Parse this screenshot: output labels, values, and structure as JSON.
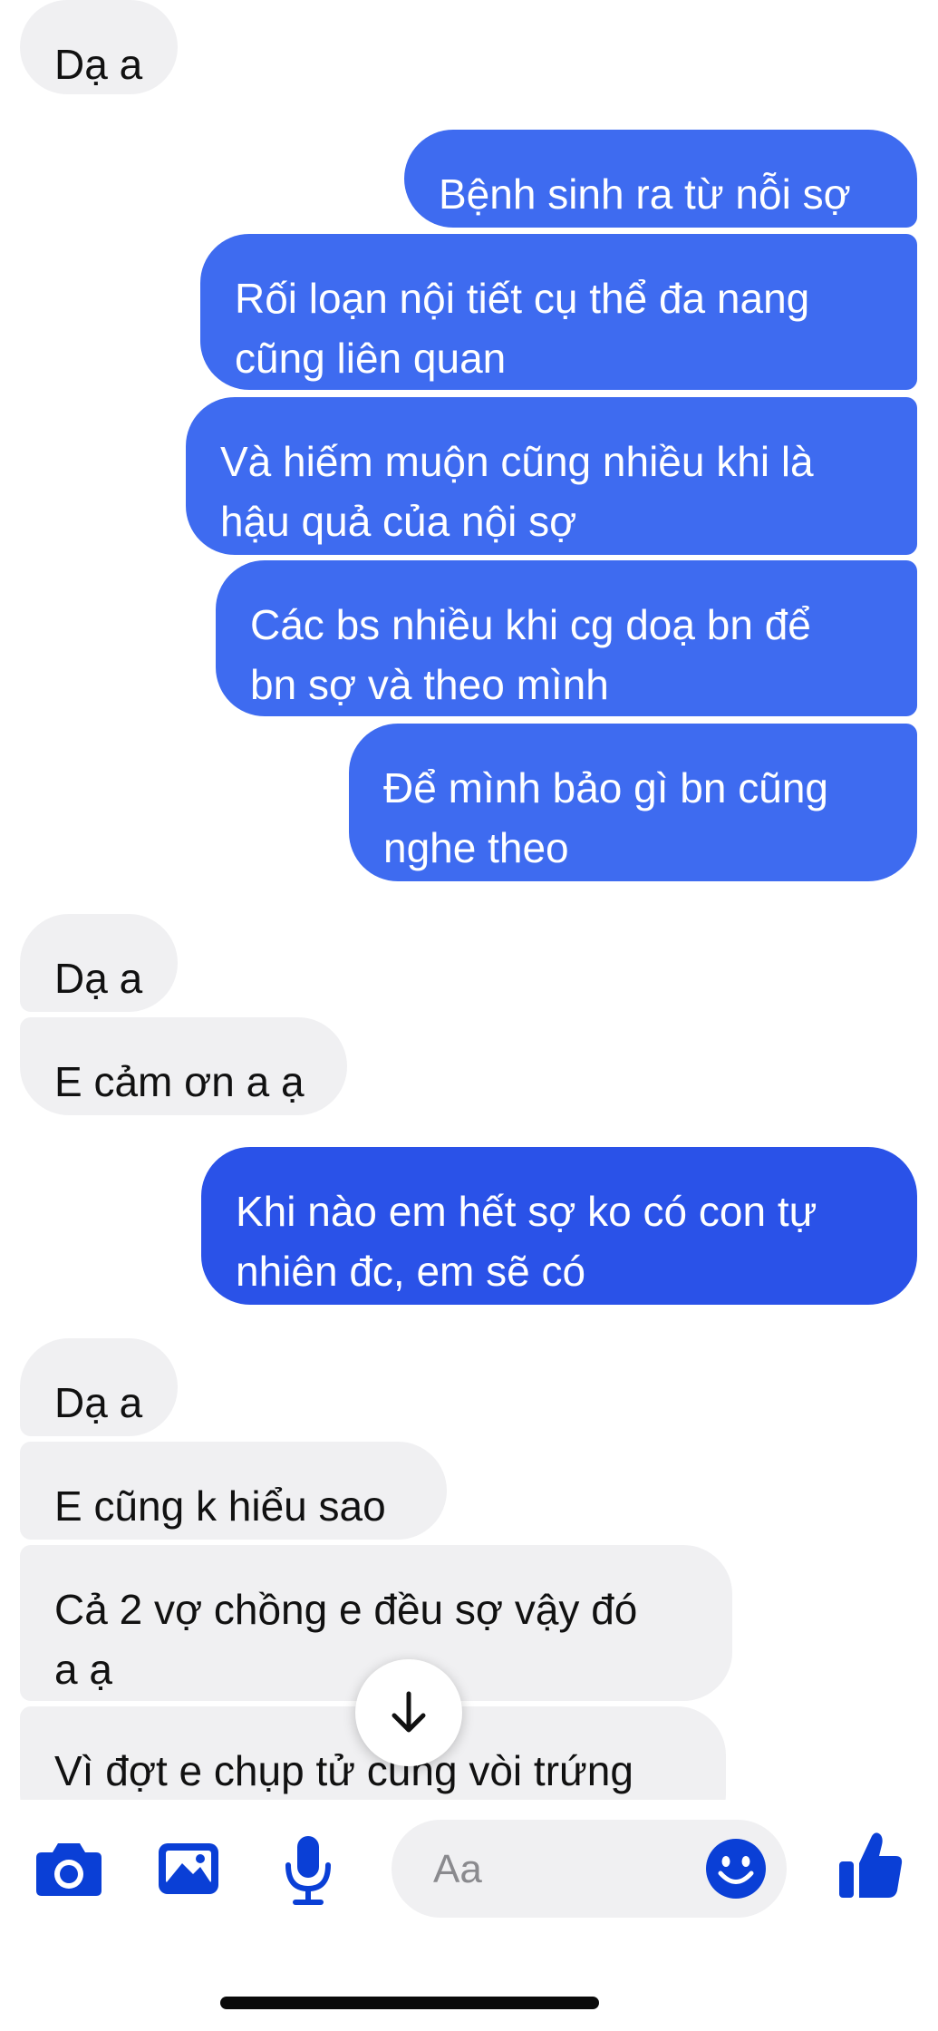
{
  "conversation": {
    "messages": [
      {
        "direction": "incoming",
        "text": "Dạ a"
      },
      {
        "direction": "outgoing",
        "text": "Bệnh sinh ra từ nỗi sợ"
      },
      {
        "direction": "outgoing",
        "text": "Rối loạn nội tiết cụ thể đa nang\ncũng liên quan"
      },
      {
        "direction": "outgoing",
        "text": "Và hiếm muộn cũng nhiều khi là\nhậu quả của nội sợ"
      },
      {
        "direction": "outgoing",
        "text": "Các bs nhiều khi cg doạ bn để\nbn sợ và theo mình"
      },
      {
        "direction": "outgoing",
        "text": "Để mình bảo gì bn cũng\nnghe theo"
      },
      {
        "direction": "incoming",
        "text": "Dạ a"
      },
      {
        "direction": "incoming",
        "text": "E cảm ơn a ạ"
      },
      {
        "direction": "outgoing",
        "text": "Khi nào em hết sợ ko có con tự\nnhiên đc, em sẽ có"
      },
      {
        "direction": "incoming",
        "text": "Dạ a"
      },
      {
        "direction": "incoming",
        "text": "E cũng k hiểu sao"
      },
      {
        "direction": "incoming",
        "text": "Cả 2 vợ chồng e đều sợ vậy đó\na ạ"
      },
      {
        "direction": "incoming",
        "text": "Vì đợt e chụp tử cung vòi trứng"
      }
    ]
  },
  "scroll_button": {
    "icon": "arrow-down-icon"
  },
  "composer": {
    "placeholder": "Aa",
    "value": "",
    "icons": [
      "camera-icon",
      "image-icon",
      "microphone-icon",
      "smile-icon",
      "thumbs-up-icon"
    ]
  },
  "colors": {
    "outgoing_bubble": "#3e6bf0",
    "incoming_bubble": "#f0f0f2",
    "accent": "#0a3fd6"
  }
}
